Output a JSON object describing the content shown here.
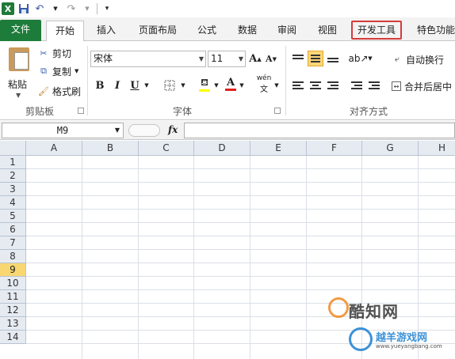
{
  "qat": {
    "app_icon": "X",
    "save_icon": "save-icon",
    "undo_icon": "undo-icon",
    "redo_icon": "redo-icon",
    "customize_icon": "customize-icon"
  },
  "tabs": {
    "file": "文件",
    "items": [
      "开始",
      "插入",
      "页面布局",
      "公式",
      "数据",
      "审阅",
      "视图",
      "开发工具",
      "特色功能"
    ]
  },
  "ribbon": {
    "clipboard": {
      "paste": "粘贴",
      "cut": "剪切",
      "copy": "复制",
      "format_painter": "格式刷",
      "label": "剪贴板"
    },
    "font": {
      "font_name": "宋体",
      "font_size": "11",
      "bold": "B",
      "italic": "I",
      "underline": "U",
      "grow": "A",
      "shrink": "A",
      "font_color": "A",
      "wen": "wén",
      "label": "字体"
    },
    "alignment": {
      "wrap_text": "自动换行",
      "merge_center": "合并后居中",
      "label": "对齐方式"
    }
  },
  "formula_bar": {
    "name_box": "M9",
    "fx": "fx",
    "value": ""
  },
  "grid": {
    "columns": [
      "A",
      "B",
      "C",
      "D",
      "E",
      "F",
      "G",
      "H"
    ],
    "rows": [
      "1",
      "2",
      "3",
      "4",
      "5",
      "6",
      "7",
      "8",
      "9",
      "10",
      "11",
      "12",
      "13",
      "14"
    ],
    "selected_row": "9"
  },
  "watermark": {
    "brand": "酷知网",
    "site": "越羊游戏网",
    "url": "www.yueyangbang.com"
  },
  "colors": {
    "file_tab": "#1e7c3a",
    "highlight_border": "#d63b3b",
    "selected_row_header": "#f8d773",
    "header_bg": "#e6ebf2"
  }
}
